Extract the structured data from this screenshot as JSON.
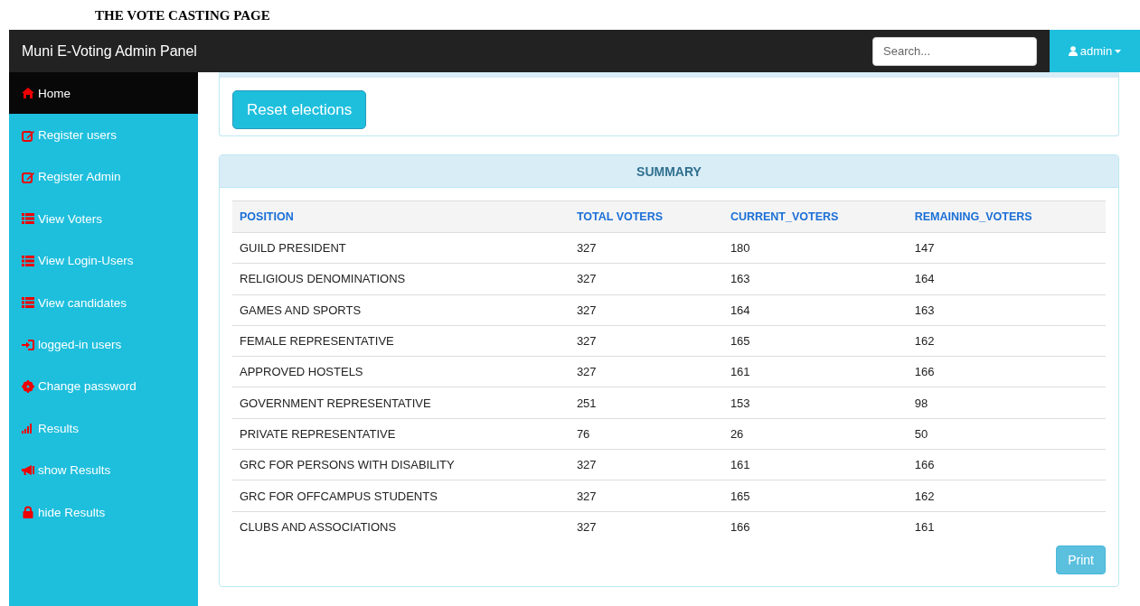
{
  "caption": "THE VOTE CASTING PAGE",
  "navbar": {
    "brand": "Muni E-Voting Admin Panel",
    "search": {
      "placeholder": "Search..."
    },
    "user": "admin"
  },
  "sidebar": {
    "items": [
      {
        "label": "Home",
        "kind": "home",
        "selected": true
      },
      {
        "label": "Register users",
        "kind": "edit",
        "selected": false
      },
      {
        "label": "Register Admin",
        "kind": "edit",
        "selected": false
      },
      {
        "label": "View Voters",
        "kind": "list",
        "selected": false
      },
      {
        "label": "View Login-Users",
        "kind": "list",
        "selected": false
      },
      {
        "label": "View candidates",
        "kind": "list",
        "selected": false
      },
      {
        "label": "logged-in users",
        "kind": "login",
        "selected": false
      },
      {
        "label": "Change password",
        "kind": "gear",
        "selected": false
      },
      {
        "label": "Results",
        "kind": "signal",
        "selected": false
      },
      {
        "label": "show Results",
        "kind": "bullhorn",
        "selected": false
      },
      {
        "label": "hide Results",
        "kind": "lock",
        "selected": false
      }
    ]
  },
  "reset_button": "Reset elections",
  "summary": {
    "title": "SUMMARY",
    "table": {
      "columns": [
        "POSITION",
        "TOTAL VOTERS",
        "CURRENT_VOTERS",
        "REMAINING_VOTERS"
      ],
      "rows": [
        [
          "GUILD PRESIDENT",
          "327",
          "180",
          "147"
        ],
        [
          "RELIGIOUS DENOMINATIONS",
          "327",
          "163",
          "164"
        ],
        [
          "GAMES AND SPORTS",
          "327",
          "164",
          "163"
        ],
        [
          "FEMALE REPRESENTATIVE",
          "327",
          "165",
          "162"
        ],
        [
          "APPROVED HOSTELS",
          "327",
          "161",
          "166"
        ],
        [
          "GOVERNMENT REPRESENTATIVE",
          "251",
          "153",
          "98"
        ],
        [
          "PRIVATE REPRESENTATIVE",
          "76",
          "26",
          "50"
        ],
        [
          "GRC FOR PERSONS WITH DISABILITY",
          "327",
          "161",
          "166"
        ],
        [
          "GRC FOR OFFCAMPUS STUDENTS",
          "327",
          "165",
          "162"
        ],
        [
          "CLUBS AND ASSOCIATIONS",
          "327",
          "166",
          "161"
        ]
      ]
    },
    "print_button": "Print"
  }
}
